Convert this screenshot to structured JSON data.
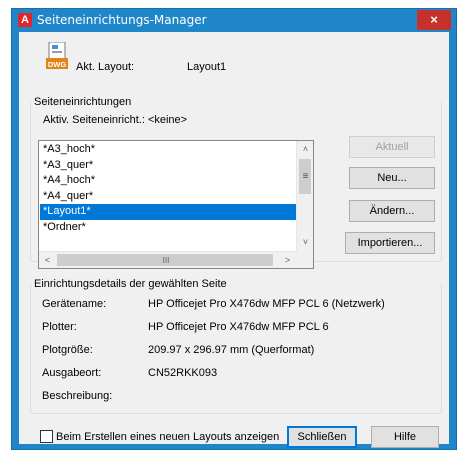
{
  "window": {
    "title": "Seiteneinrichtungs-Manager",
    "app_icon_letter": "A",
    "close_glyph": "×"
  },
  "current_layout": {
    "label": "Akt. Layout:",
    "value": "Layout1",
    "icon_text": "DWG"
  },
  "page_setups": {
    "group_title": "Seiteneinrichtungen",
    "active_label": "Aktiv. Seiteneinricht.: <keine>",
    "items": [
      "*A3_hoch*",
      "*A3_quer*",
      "*A4_hoch*",
      "*A4_quer*",
      "*Layout1*",
      "*Ordner*"
    ],
    "selected_index": 4
  },
  "buttons": {
    "current": "Aktuell",
    "new": "Neu...",
    "modify": "Ändern...",
    "import": "Importieren...",
    "close": "Schließen",
    "help": "Hilfe"
  },
  "details": {
    "group_title": "Einrichtungsdetails der gewählten Seite",
    "rows": [
      {
        "label": "Gerätename:",
        "value": "HP Officejet Pro X476dw MFP PCL 6 (Netzwerk)"
      },
      {
        "label": "Plotter:",
        "value": "HP Officejet Pro X476dw MFP PCL 6"
      },
      {
        "label": "Plotgröße:",
        "value": "209.97 x 296.97 mm (Querformat)"
      },
      {
        "label": "Ausgabeort:",
        "value": "CN52RKK093"
      },
      {
        "label": "Beschreibung:",
        "value": ""
      }
    ]
  },
  "footer": {
    "checkbox_label": "Beim Erstellen eines neuen Layouts anzeigen",
    "checkbox_checked": false
  },
  "scrollbar": {
    "up": "˄",
    "down": "˅",
    "left": "<",
    "right": ">",
    "grip_v": "≡",
    "grip_h": "III"
  },
  "colors": {
    "titlebar": "#1f86c9",
    "selection": "#0078d7",
    "close_button": "#c7312c"
  }
}
